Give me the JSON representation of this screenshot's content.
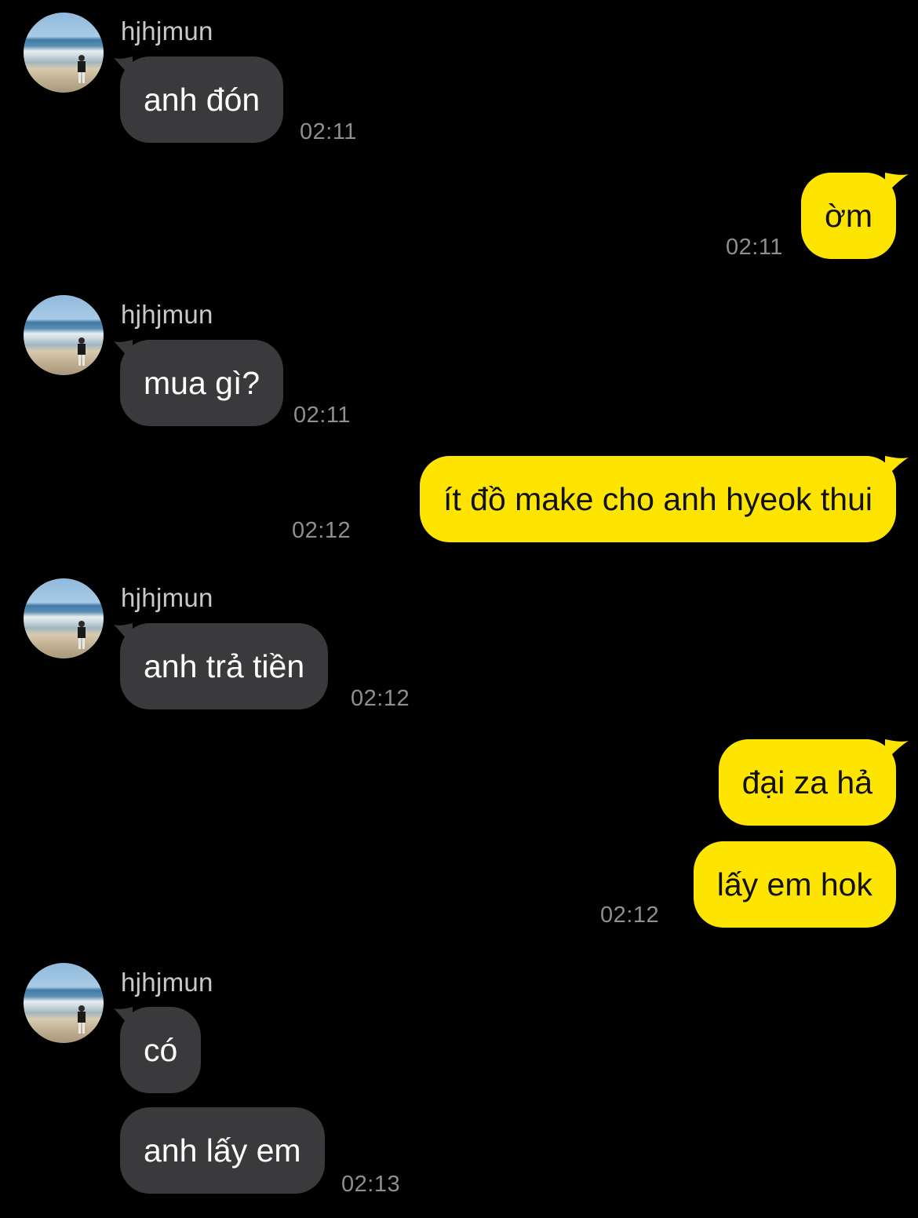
{
  "contact": {
    "name": "hjhjmun"
  },
  "colors": {
    "background": "#000000",
    "incoming_bubble": "#3a3a3c",
    "outgoing_bubble": "#fee500",
    "timestamp": "#8e8e93"
  },
  "messages": [
    {
      "direction": "incoming",
      "sender": "hjhjmun",
      "text": "anh đón",
      "time": "02:11"
    },
    {
      "direction": "outgoing",
      "text": "ờm",
      "time": "02:11"
    },
    {
      "direction": "incoming",
      "sender": "hjhjmun",
      "text": "mua gì?",
      "time": "02:11"
    },
    {
      "direction": "outgoing",
      "text": "ít đồ make cho anh hyeok thui",
      "time": "02:12"
    },
    {
      "direction": "incoming",
      "sender": "hjhjmun",
      "text": "anh trả tiền",
      "time": "02:12"
    },
    {
      "direction": "outgoing",
      "text": "đại za hả",
      "time": ""
    },
    {
      "direction": "outgoing",
      "text": "lấy em hok",
      "time": "02:12"
    },
    {
      "direction": "incoming",
      "sender": "hjhjmun",
      "text": "có",
      "time": ""
    },
    {
      "direction": "incoming",
      "text": "anh lấy em",
      "time": "02:13"
    }
  ]
}
